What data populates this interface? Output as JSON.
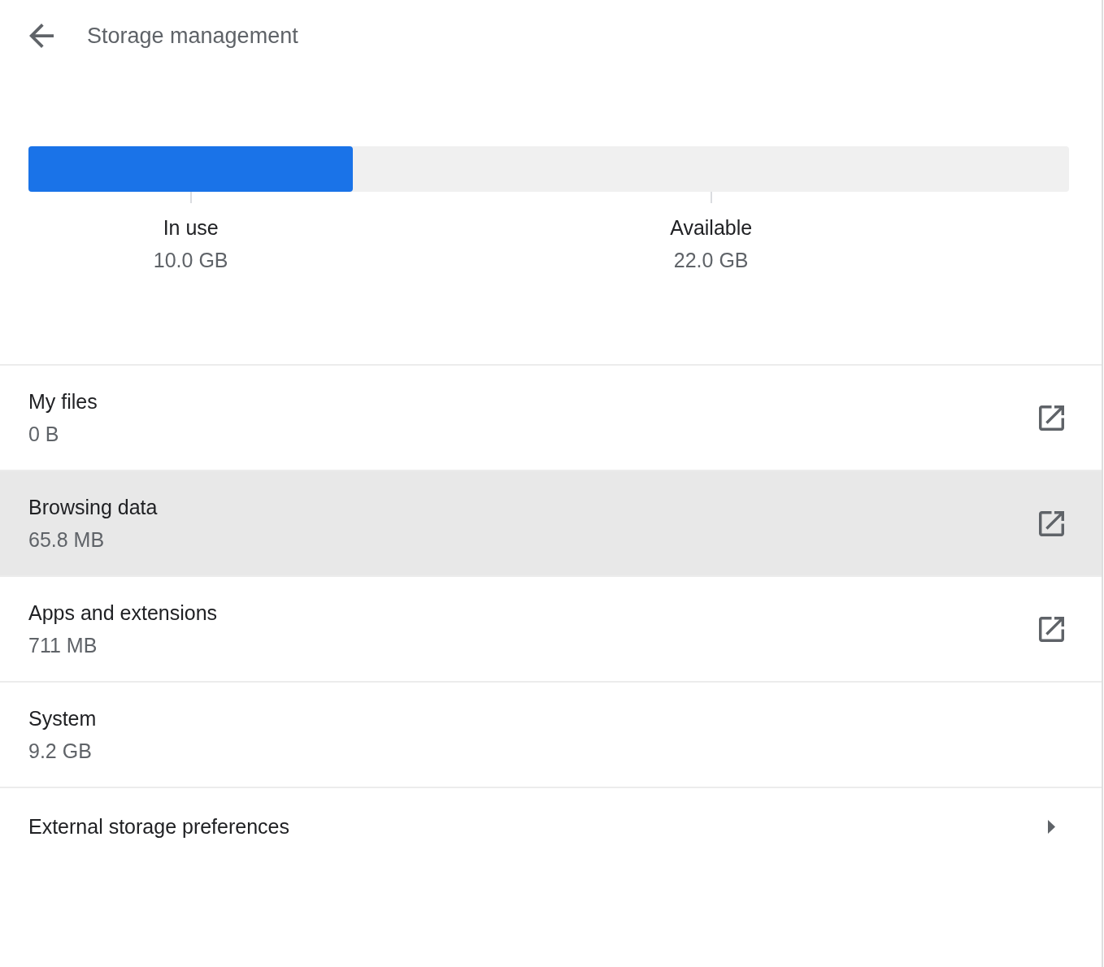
{
  "header": {
    "title": "Storage management"
  },
  "usage_bar": {
    "level": 0.312,
    "segments": [
      {
        "label": "In use",
        "value": "10.0 GB"
      },
      {
        "label": "Available",
        "value": "22.0 GB"
      }
    ]
  },
  "items": [
    {
      "kind": "external",
      "title": "My files",
      "value": "0 B",
      "highlighted": false
    },
    {
      "kind": "external",
      "title": "Browsing data",
      "value": "65.8 MB",
      "highlighted": true
    },
    {
      "kind": "external",
      "title": "Apps and extensions",
      "value": "711 MB",
      "highlighted": false
    },
    {
      "kind": "info",
      "title": "System",
      "value": "9.2 GB",
      "highlighted": false
    },
    {
      "kind": "subpage",
      "title": "External storage preferences",
      "highlighted": false
    }
  ]
}
